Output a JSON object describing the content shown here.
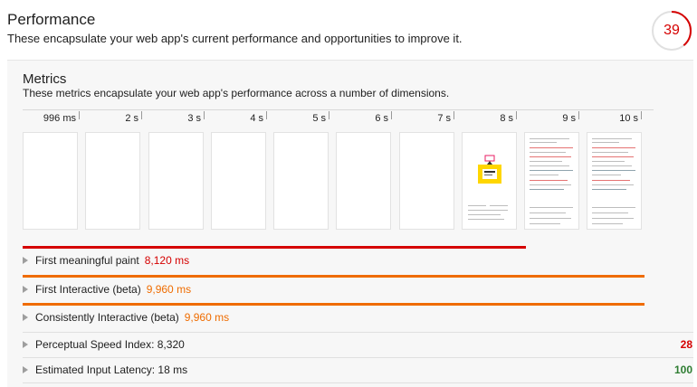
{
  "header": {
    "title": "Performance",
    "description": "These encapsulate your web app's current performance and opportunities to improve it.",
    "score": "39",
    "score_fraction": 0.39,
    "score_color": "#d50000"
  },
  "metrics": {
    "title": "Metrics",
    "description": "These metrics encapsulate your web app's performance across a number of dimensions."
  },
  "timeline": [
    "996 ms",
    "2 s",
    "3 s",
    "4 s",
    "5 s",
    "6 s",
    "7 s",
    "8 s",
    "9 s",
    "10 s"
  ],
  "rows": [
    {
      "label": "First meaningful paint",
      "value": "8,120 ms",
      "color": "#d50000",
      "bar_fraction": 0.81
    },
    {
      "label": "First Interactive (beta)",
      "value": "9,960 ms",
      "color": "#ef6c00",
      "bar_fraction": 1.0
    },
    {
      "label": "Consistently Interactive (beta)",
      "value": "9,960 ms",
      "color": "#ef6c00",
      "bar_fraction": 1.0
    },
    {
      "label": "Perceptual Speed Index: 8,320",
      "score": "28",
      "score_color": "#d50000"
    },
    {
      "label": "Estimated Input Latency: 18 ms",
      "score": "100",
      "score_color": "#2e7d32"
    }
  ]
}
